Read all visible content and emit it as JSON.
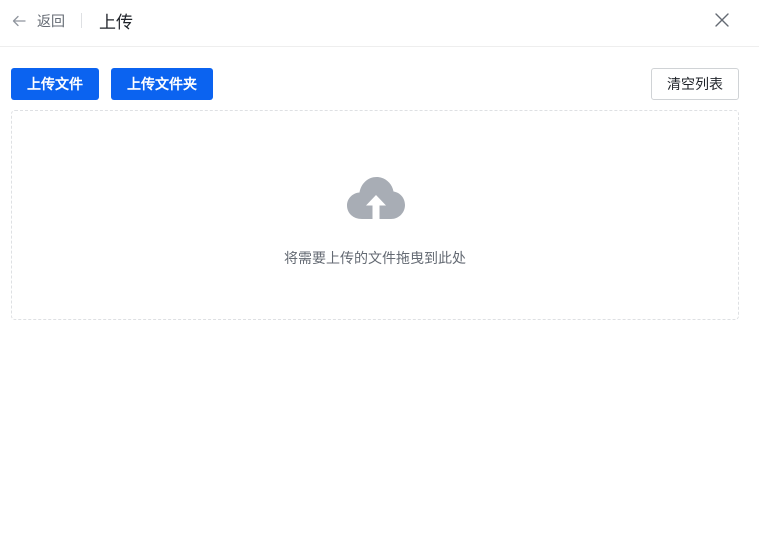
{
  "header": {
    "back_label": "返回",
    "title": "上传"
  },
  "toolbar": {
    "upload_file_label": "上传文件",
    "upload_folder_label": "上传文件夹",
    "clear_list_label": "清空列表"
  },
  "dropzone": {
    "hint": "将需要上传的文件拖曳到此处",
    "icon": "cloud-upload-icon"
  },
  "colors": {
    "primary": "#0b63f0",
    "icon_gray": "#a8adb5",
    "text_secondary": "#646a73"
  }
}
